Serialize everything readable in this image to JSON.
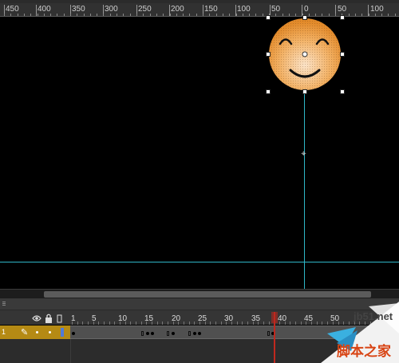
{
  "ruler": {
    "labels": [
      "450",
      "400",
      "350",
      "300",
      "250",
      "200",
      "150",
      "100",
      "50",
      "0",
      "50",
      "100"
    ]
  },
  "timeline": {
    "frame_labels": [
      "1",
      "5",
      "10",
      "15",
      "20",
      "25",
      "30",
      "35",
      "40",
      "45",
      "50"
    ],
    "layer": {
      "name": "1"
    },
    "current_frame": 38
  },
  "watermark": {
    "site": "jb51.net",
    "text": "脚本之家"
  },
  "colors": {
    "guide": "#2fb7c7",
    "layer_highlight": "#b58a14",
    "playhead": "#c0281e",
    "smiley_face": "#f0a048"
  },
  "icons": {
    "eye": "eye-icon",
    "lock": "lock-icon",
    "outline": "outline-icon",
    "pencil": "pencil-icon",
    "registration": "registration-point-icon"
  }
}
